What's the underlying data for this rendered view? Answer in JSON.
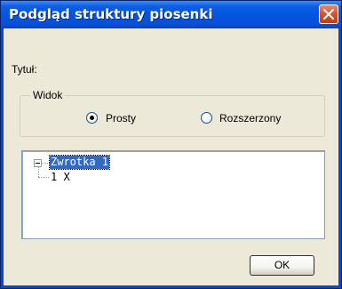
{
  "window": {
    "title": "Podgląd struktury piosenki",
    "close_icon": "close-icon"
  },
  "fields": {
    "title_label": "Tytuł:"
  },
  "view_group": {
    "legend": "Widok",
    "options": [
      {
        "label": "Prosty",
        "selected": true
      },
      {
        "label": "Rozszerzony",
        "selected": false
      }
    ]
  },
  "tree": {
    "root": {
      "label": "Zwrotka 1",
      "expanded": true,
      "selected": true
    },
    "children": [
      {
        "label": "1 X"
      }
    ]
  },
  "buttons": {
    "ok_label": "OK"
  },
  "colors": {
    "titlebar": "#0354df",
    "selection": "#316ac5",
    "close_button": "#d5522c",
    "dialog_background": "#ece9d8"
  }
}
